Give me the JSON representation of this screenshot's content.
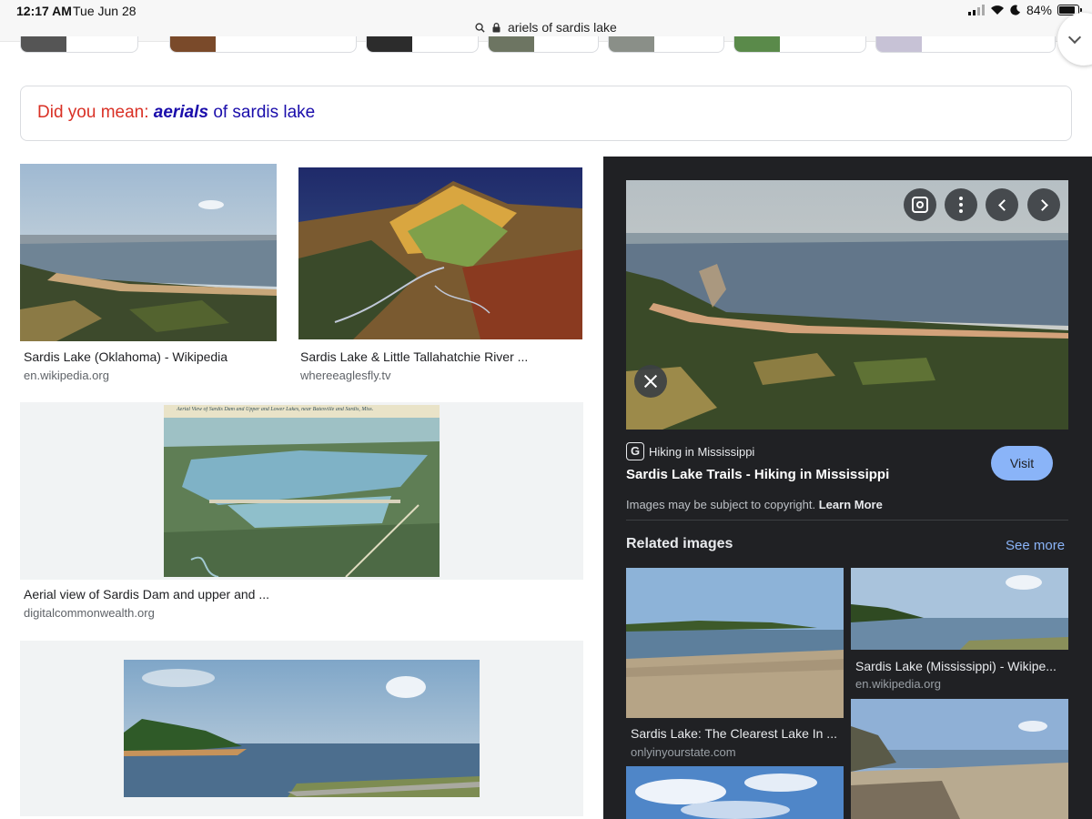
{
  "status_bar": {
    "time": "12:17 AM",
    "date": "Tue Jun 28",
    "url": "ariels of sardis lake",
    "battery": "84%",
    "battery_level": 0.84
  },
  "did_you_mean": {
    "label": "Did you mean:",
    "suggestion_bold": "aerials",
    "suggestion_rest": "of sardis lake"
  },
  "results": [
    {
      "title": "Sardis Lake (Oklahoma) - Wikipedia",
      "site": "en.wikipedia.org"
    },
    {
      "title": "Sardis Lake & Little Tallahatchie River ...",
      "site": "whereeaglesfly.tv"
    },
    {
      "title": "Aerial view of Sardis Dam and upper and ...",
      "site": "digitalcommonwealth.org",
      "postcard_caption": "Aerial View of Sardis Dam and Upper and Lower Lakes, near Batesville and Sardis, Miss."
    }
  ],
  "panel": {
    "source_icon": "G",
    "source_name": "Hiking in Mississippi",
    "title": "Sardis Lake Trails - Hiking in Mississippi",
    "visit_label": "Visit",
    "copyright_text": "Images may be subject to copyright.",
    "learn_more": "Learn More",
    "related_heading": "Related images",
    "see_more": "See more",
    "related": [
      {
        "title": "Sardis Lake: The Clearest Lake In ...",
        "site": "onlyinyourstate.com"
      },
      {
        "title": "Sardis Lake (Mississippi) - Wikipe...",
        "site": "en.wikipedia.org"
      }
    ]
  },
  "colors": {
    "accent_blue": "#8ab4f8",
    "link_blue": "#1a0dab",
    "did_you_mean_red": "#d93025",
    "panel_bg": "#202124"
  },
  "icons": [
    "search-icon",
    "lock-icon",
    "wifi-icon",
    "moon-icon",
    "battery-icon",
    "lens-icon",
    "more-vert-icon",
    "chevron-left-icon",
    "chevron-right-icon",
    "close-icon",
    "chevron-down-icon"
  ]
}
